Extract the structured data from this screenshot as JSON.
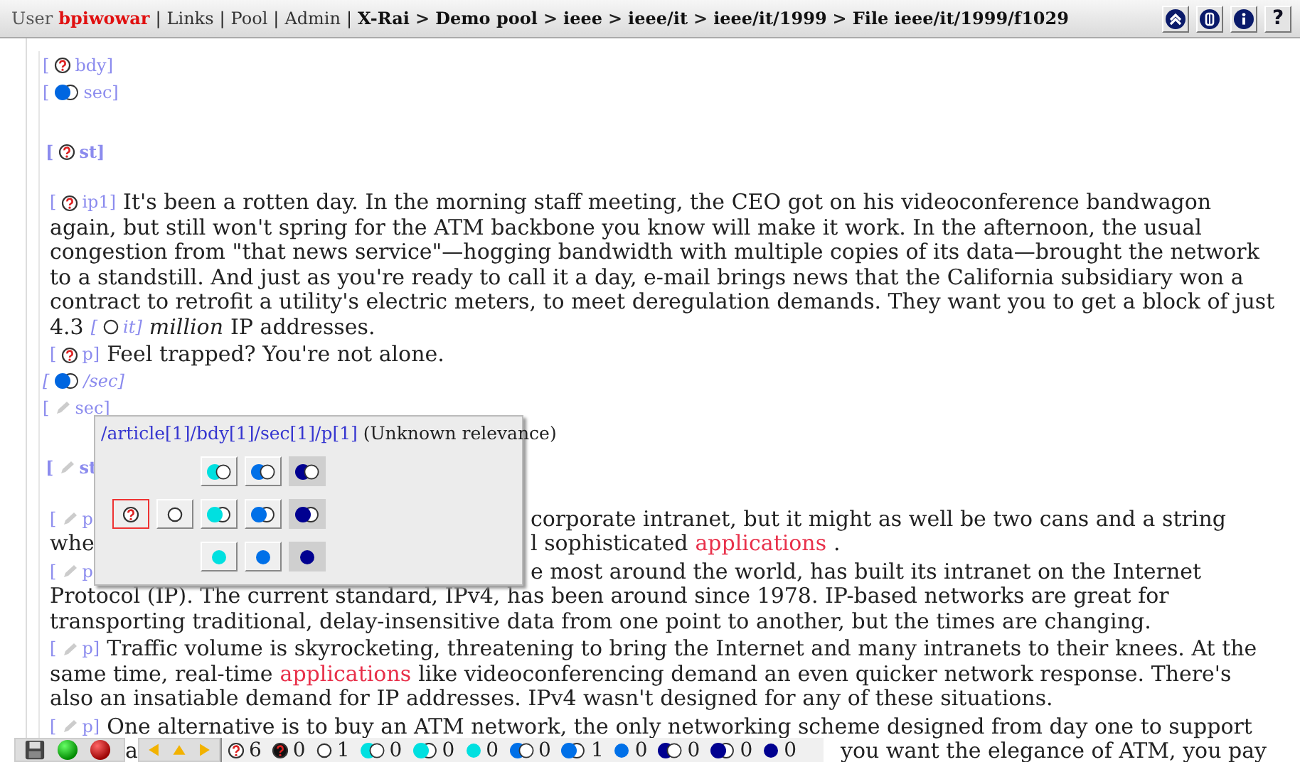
{
  "top_bar": {
    "items": [
      {
        "kind": "label",
        "text": "User"
      },
      {
        "kind": "user",
        "text": "bpiwowar"
      },
      {
        "kind": "sep",
        "text": "|"
      },
      {
        "kind": "link",
        "text": "Links"
      },
      {
        "kind": "sep",
        "text": "|"
      },
      {
        "kind": "link",
        "text": "Pool"
      },
      {
        "kind": "sep",
        "text": "|"
      },
      {
        "kind": "link",
        "text": "Admin"
      },
      {
        "kind": "sep",
        "text": "|"
      },
      {
        "kind": "crumb",
        "text": "X-Rai"
      },
      {
        "kind": "crumbsep",
        "text": ">"
      },
      {
        "kind": "crumb",
        "text": "Demo pool"
      },
      {
        "kind": "crumbsep",
        "text": ">"
      },
      {
        "kind": "crumb",
        "text": "ieee"
      },
      {
        "kind": "crumbsep",
        "text": ">"
      },
      {
        "kind": "crumb",
        "text": "ieee/it"
      },
      {
        "kind": "crumbsep",
        "text": ">"
      },
      {
        "kind": "crumb",
        "text": "ieee/it/1999"
      },
      {
        "kind": "crumbsep",
        "text": ">"
      },
      {
        "kind": "crumb",
        "text": "File ieee/it/1999/f1029"
      }
    ],
    "buttons": [
      {
        "kind": "up"
      },
      {
        "kind": "book"
      },
      {
        "kind": "info"
      },
      {
        "kind": "help",
        "label": "?"
      }
    ]
  },
  "document": [
    {
      "kind": "tag",
      "tag": {
        "open": "[",
        "kind": "unknown",
        "label": "bdy]"
      }
    },
    {
      "kind": "tag",
      "tag": {
        "open": "[",
        "kind": "pair-front",
        "color": "#0066e0",
        "label": "sec]"
      }
    },
    {
      "kind": "heading",
      "tag": {
        "open": "[",
        "kind": "unknown",
        "label": "st]"
      }
    },
    {
      "kind": "para",
      "lines": [
        {
          "kind": "plain",
          "segments": [
            {
              "kind": "tag",
              "tag": {
                "open": "[",
                "kind": "unknown",
                "label": "ip1]"
              }
            },
            {
              "kind": "text",
              "text": "It's been a rotten day. In the morning staff meeting, the CEO got on his videoconference bandwagon"
            }
          ]
        },
        {
          "kind": "plain",
          "segments": [
            {
              "kind": "text",
              "text": "again, but still won't spring for the ATM backbone you know will make it work. In the afternoon, the usual"
            }
          ]
        },
        {
          "kind": "plain",
          "segments": [
            {
              "kind": "text",
              "text": "congestion from \"that news service\"—hogging bandwidth with multiple copies of its data—brought the network"
            }
          ]
        },
        {
          "kind": "plain",
          "segments": [
            {
              "kind": "text",
              "text": "to a standstill. And just as you're ready to call it a day, e-mail brings news that the California subsidiary won a"
            }
          ]
        },
        {
          "kind": "plain",
          "segments": [
            {
              "kind": "text",
              "text": "contract to retrofit a utility's electric meters, to meet deregulation demands. They want you to get a block of just"
            }
          ]
        },
        {
          "kind": "plain",
          "segments": [
            {
              "kind": "text",
              "text": "4.3"
            },
            {
              "kind": "tag",
              "tag": {
                "open": "[",
                "kind": "empty",
                "label": "it]",
                "italic": true
              }
            },
            {
              "kind": "emph",
              "text": "million"
            },
            {
              "kind": "text",
              "text": "IP addresses."
            }
          ]
        }
      ]
    },
    {
      "kind": "para",
      "lines": [
        {
          "kind": "plain",
          "segments": [
            {
              "kind": "tag",
              "tag": {
                "open": "[",
                "kind": "unknown",
                "label": "p]"
              }
            },
            {
              "kind": "text",
              "text": "Feel trapped? You're not alone."
            }
          ]
        }
      ]
    },
    {
      "kind": "tag",
      "tag": {
        "open": "[",
        "kind": "pair-front",
        "color": "#0066e0",
        "label": "/sec]",
        "italic": true
      }
    },
    {
      "kind": "tag",
      "tag": {
        "open": "[",
        "kind": "pencil",
        "label": "sec]"
      }
    },
    {
      "kind": "heading",
      "tag": {
        "open": "[",
        "kind": "pencil",
        "label": "st"
      }
    },
    {
      "kind": "para",
      "lines": [
        {
          "kind": "behind-popup",
          "segments": [
            {
              "kind": "tag",
              "tag": {
                "open": "[",
                "kind": "pencil",
                "label": "p"
              }
            }
          ],
          "right": [
            {
              "kind": "text",
              "text": "corporate intranet, but it might as well be two cans and a string"
            }
          ]
        },
        {
          "kind": "behind-popup",
          "segments": [
            {
              "kind": "text",
              "text": "whe"
            }
          ],
          "right": [
            {
              "kind": "text",
              "text": "l sophisticated"
            },
            {
              "kind": "term",
              "text": "applications"
            },
            {
              "kind": "text",
              "text": "."
            }
          ]
        }
      ]
    },
    {
      "kind": "para",
      "lines": [
        {
          "kind": "behind-popup",
          "segments": [
            {
              "kind": "tag",
              "tag": {
                "open": "[",
                "kind": "pencil",
                "label": "p"
              }
            }
          ],
          "right": [
            {
              "kind": "text",
              "text": "e most around the world, has built its intranet on the Internet"
            }
          ]
        },
        {
          "kind": "plain",
          "segments": [
            {
              "kind": "text",
              "text": "Protocol (IP). The current standard, IPv4, has been around since 1978. IP-based networks are great for"
            }
          ]
        },
        {
          "kind": "plain",
          "segments": [
            {
              "kind": "text",
              "text": "transporting traditional, delay-insensitive data from one point to another, but the times are changing."
            }
          ]
        }
      ]
    },
    {
      "kind": "para",
      "lines": [
        {
          "kind": "plain",
          "segments": [
            {
              "kind": "tag",
              "tag": {
                "open": "[",
                "kind": "pencil",
                "label": "p]"
              }
            },
            {
              "kind": "text",
              "text": "Traffic volume is skyrocketing, threatening to bring the Internet and many intranets to their knees. At the"
            }
          ]
        },
        {
          "kind": "plain",
          "segments": [
            {
              "kind": "text",
              "text": "same time, real-time"
            },
            {
              "kind": "term",
              "text": "applications"
            },
            {
              "kind": "text",
              "text": "like videoconferencing demand an even quicker network response. There's"
            }
          ]
        },
        {
          "kind": "plain",
          "segments": [
            {
              "kind": "text",
              "text": "also an insatiable demand for IP addresses. IPv4 wasn't designed for any of these situations."
            }
          ]
        }
      ]
    },
    {
      "kind": "para",
      "lines": [
        {
          "kind": "plain",
          "segments": [
            {
              "kind": "tag",
              "tag": {
                "open": "[",
                "kind": "pencil",
                "label": "p]"
              }
            },
            {
              "kind": "text",
              "text": "One alternative is to buy an ATM network, the only networking scheme designed from day one to support"
            }
          ]
        },
        {
          "kind": "behind-toolbar",
          "segments": [
            {
              "kind": "text",
              "text": "a"
            }
          ],
          "right": [
            {
              "kind": "text",
              "text": "you want the elegance of ATM, you pay"
            }
          ]
        }
      ]
    }
  ],
  "popup": {
    "path": "/article[1]/bdy[1]/sec[1]/p[1]",
    "status": "(Unknown relevance)",
    "rows": [
      {
        "buttons": [
          {
            "kind": "pair-back",
            "color": "#00e0e0",
            "selected": false,
            "disabled": false
          },
          {
            "kind": "pair-back",
            "color": "#0070e8",
            "selected": false,
            "disabled": false
          },
          {
            "kind": "pair-back",
            "color": "#000090",
            "selected": false,
            "disabled": true
          }
        ]
      },
      {
        "buttons": [
          {
            "kind": "unknown",
            "selected": true,
            "disabled": false
          },
          {
            "kind": "empty",
            "selected": false,
            "disabled": false
          },
          {
            "kind": "pair-front",
            "color": "#00e0e0",
            "selected": false,
            "disabled": false
          },
          {
            "kind": "pair-front",
            "color": "#0070e8",
            "selected": false,
            "disabled": false
          },
          {
            "kind": "pair-front",
            "color": "#000090",
            "selected": false,
            "disabled": true
          }
        ]
      },
      {
        "buttons": [
          {
            "kind": "single",
            "color": "#00e0e0",
            "selected": false,
            "disabled": false
          },
          {
            "kind": "single",
            "color": "#0070e8",
            "selected": false,
            "disabled": false
          },
          {
            "kind": "single",
            "color": "#000090",
            "selected": false,
            "disabled": true
          }
        ]
      }
    ]
  },
  "bottom_toolbar": {
    "actions": [
      {
        "kind": "save"
      },
      {
        "kind": "accept"
      },
      {
        "kind": "reject"
      }
    ],
    "navigation": [
      {
        "kind": "left"
      },
      {
        "kind": "up"
      },
      {
        "kind": "right"
      }
    ],
    "counts": [
      {
        "kind": "unknown",
        "count": "6"
      },
      {
        "kind": "unknown-dark",
        "count": "0"
      },
      {
        "kind": "empty",
        "count": "1"
      },
      {
        "kind": "pair-back",
        "color": "#00e0e0",
        "count": "0"
      },
      {
        "kind": "pair-front",
        "color": "#00e0e0",
        "count": "0"
      },
      {
        "kind": "single",
        "color": "#00e0e0",
        "count": "0"
      },
      {
        "kind": "pair-back",
        "color": "#0070e8",
        "count": "0"
      },
      {
        "kind": "pair-front",
        "color": "#0070e8",
        "count": "1"
      },
      {
        "kind": "single",
        "color": "#0070e8",
        "count": "0"
      },
      {
        "kind": "pair-back",
        "color": "#000090",
        "count": "0"
      },
      {
        "kind": "pair-front",
        "color": "#000090",
        "count": "0"
      },
      {
        "kind": "single",
        "color": "#000090",
        "count": "0"
      }
    ]
  }
}
